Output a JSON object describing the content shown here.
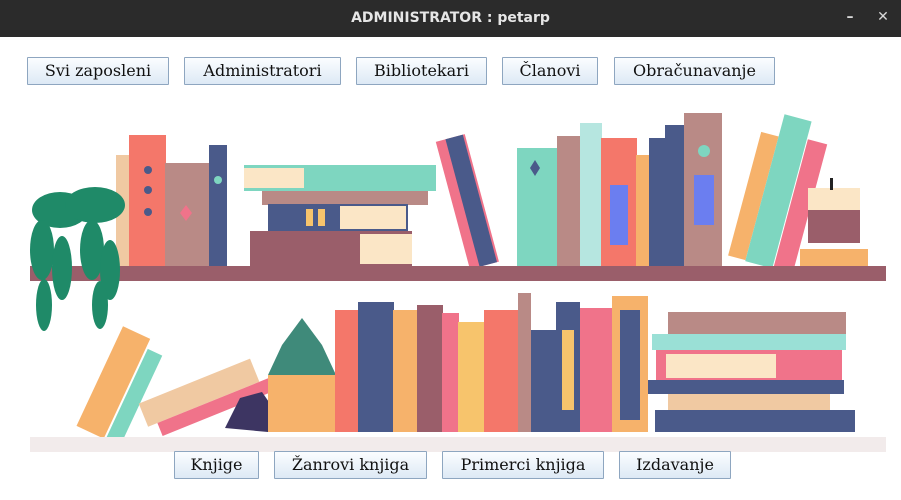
{
  "window": {
    "title": "ADMINISTRATOR : petarp",
    "minimize_glyph": "–",
    "close_glyph": "✕"
  },
  "top_nav": {
    "employees": "Svi zaposleni",
    "administrators": "Administratori",
    "librarians": "Bibliotekari",
    "members": "Članovi",
    "billing": "Obračunavanje"
  },
  "bottom_nav": {
    "books": "Knjige",
    "genres": "Žanrovi knjiga",
    "copies": "Primerci knjiga",
    "lending": "Izdavanje"
  },
  "illustration": {
    "name": "bookshelf-illustration"
  },
  "colors": {
    "titlebar": "#2b2b2b",
    "button_border": "#8ea6c0",
    "shelf": "#9a5e6a",
    "teal": "#7ed6c0",
    "coral": "#f4776a",
    "pink": "#f0738a",
    "navy": "#4a5a8a",
    "mauve": "#b98a86",
    "plant": "#1f8a68"
  }
}
